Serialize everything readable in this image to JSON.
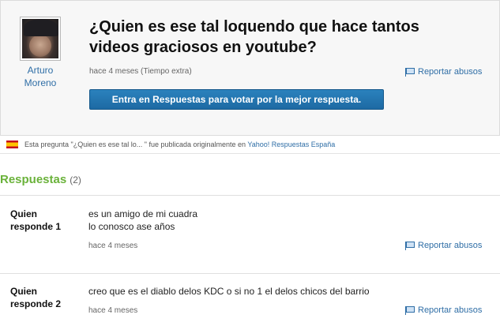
{
  "question": {
    "author_first": "Arturo",
    "author_last": "Moreno",
    "title": "¿Quien es ese tal loquendo que hace tantos videos graciosos en youtube?",
    "meta": "hace 4 meses (Tiempo extra)",
    "report_label": "Reportar abusos",
    "vote_button": "Entra en Respuestas para votar por la mejor respuesta."
  },
  "origin": {
    "prefix": "Esta pregunta \"¿Quien es ese tal lo... \" fue publicada originalmente en",
    "link": "Yahoo! Respuestas España"
  },
  "answers": {
    "title": "Respuestas",
    "count": "(2)",
    "items": [
      {
        "author_line1": "Quien",
        "author_line2": "responde 1",
        "text_line1": "es un amigo de mi cuadra",
        "text_line2": "lo conosco ase años",
        "date": "hace 4 meses",
        "report_label": "Reportar abusos"
      },
      {
        "author_line1": "Quien",
        "author_line2": "responde 2",
        "text_line1": "creo que es el diablo delos KDC o si no 1 el delos chicos del barrio",
        "text_line2": "",
        "date": "hace 4 meses",
        "report_label": "Reportar abusos"
      }
    ]
  },
  "colors": {
    "link": "#2f6ea6",
    "answers_title": "#6ab23a",
    "button": "#1d6aa3"
  }
}
